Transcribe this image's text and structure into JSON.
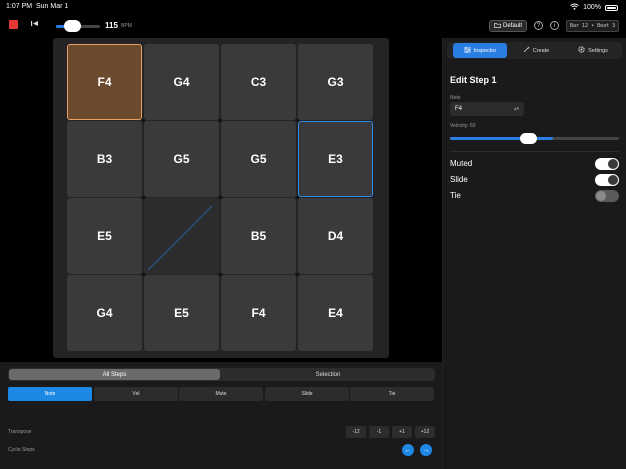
{
  "status_bar": {
    "time": "1:07 PM",
    "date": "Sun Mar 1",
    "battery": "100%"
  },
  "transport": {
    "tempo_value": "115",
    "tempo_unit": "BPM",
    "tempo_level_fraction": 0.35
  },
  "header": {
    "preset_label": "Default",
    "position_readout": "Bar 12 • Beat 3"
  },
  "grid": {
    "cells": [
      {
        "note": "F4",
        "state": "selected"
      },
      {
        "note": "G4",
        "state": "normal"
      },
      {
        "note": "C3",
        "state": "normal"
      },
      {
        "note": "G3",
        "state": "normal"
      },
      {
        "note": "B3",
        "state": "normal"
      },
      {
        "note": "G5",
        "state": "normal"
      },
      {
        "note": "G5",
        "state": "normal"
      },
      {
        "note": "E3",
        "state": "focused"
      },
      {
        "note": "E5",
        "state": "normal"
      },
      {
        "note": "",
        "state": "empty"
      },
      {
        "note": "B5",
        "state": "normal"
      },
      {
        "note": "D4",
        "state": "normal"
      },
      {
        "note": "G4",
        "state": "normal"
      },
      {
        "note": "E5",
        "state": "normal"
      },
      {
        "note": "F4",
        "state": "normal"
      },
      {
        "note": "E4",
        "state": "normal"
      }
    ]
  },
  "inspector": {
    "tabs": [
      {
        "label": "Inspector",
        "icon": "sliders-icon",
        "active": true
      },
      {
        "label": "Create",
        "icon": "wand-icon",
        "active": false
      },
      {
        "label": "Settings",
        "icon": "gear-icon",
        "active": false
      }
    ],
    "title": "Edit Step 1",
    "note_label": "Note",
    "note_value": "F4",
    "velocity_label": "Velocity: 60",
    "velocity_fraction": 0.61,
    "toggles": [
      {
        "label": "Muted",
        "on": true
      },
      {
        "label": "Slide",
        "on": true
      },
      {
        "label": "Tie",
        "on": false
      }
    ]
  },
  "bottom": {
    "scope_tabs": [
      {
        "label": "All Steps",
        "active": true
      },
      {
        "label": "Selection",
        "active": false
      }
    ],
    "property_tabs": [
      {
        "label": "Note",
        "active": true
      },
      {
        "label": "Vel",
        "active": false
      },
      {
        "label": "Mute",
        "active": false
      },
      {
        "label": "Slide",
        "active": false
      },
      {
        "label": "Tie",
        "active": false
      }
    ],
    "transpose_label": "Transpose",
    "transpose_buttons": [
      "-12",
      "-1",
      "+1",
      "+12"
    ],
    "cycle_label": "Cycle Steps"
  },
  "colors": {
    "accent": "#2a7de1",
    "stop": "#e53935",
    "selected_cell": "#6b4a2e",
    "selected_border": "#e8a060"
  }
}
